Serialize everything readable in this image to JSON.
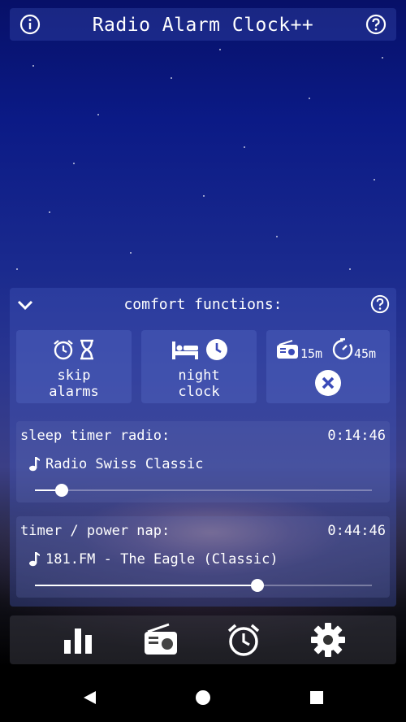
{
  "app": {
    "title": "Radio Alarm Clock++",
    "info_icon": "info-icon",
    "help_icon": "help-icon"
  },
  "comfort": {
    "title": "comfort functions:",
    "tiles": [
      {
        "label": "skip\nalarms",
        "icons": [
          "alarm-clock-icon",
          "hourglass-icon"
        ]
      },
      {
        "label": "night\nclock",
        "icons": [
          "bed-icon",
          "clock-icon"
        ]
      },
      {
        "radio_minutes": "15m",
        "timer_minutes": "45m",
        "icons": [
          "radio-icon",
          "timer-icon",
          "cancel-icon"
        ]
      }
    ]
  },
  "sleep_timer": {
    "title": "sleep timer radio:",
    "time": "0:14:46",
    "station": "Radio Swiss Classic",
    "progress": 0.08
  },
  "power_nap": {
    "title": "timer / power nap:",
    "time": "0:44:46",
    "station": "181.FM - The Eagle (Classic)",
    "progress": 0.66
  },
  "bottom_nav": [
    "stats-icon",
    "radio-icon",
    "alarm-clock-icon",
    "settings-icon"
  ],
  "colors": {
    "accent": "#3a4ab8",
    "text": "#ffffff"
  }
}
